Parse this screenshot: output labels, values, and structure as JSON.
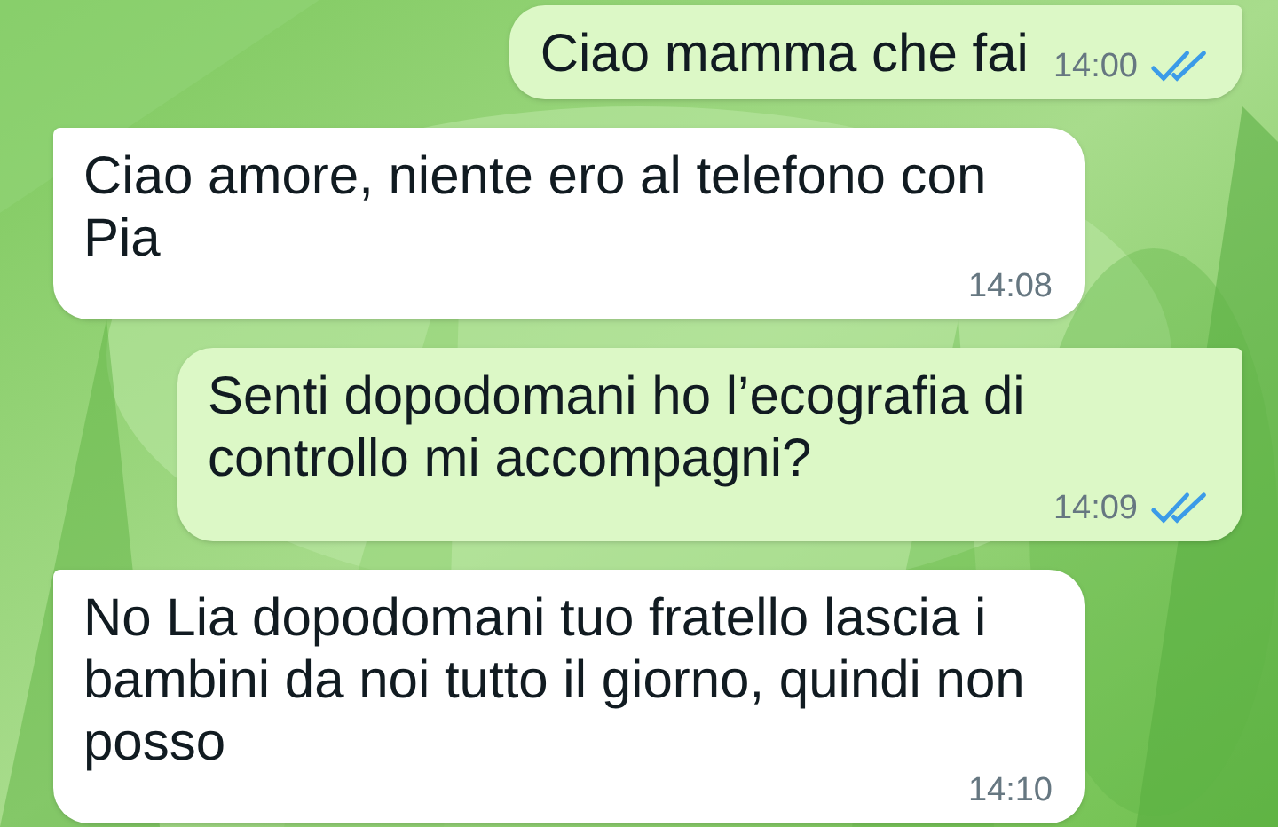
{
  "messages": [
    {
      "kind": "outgoing",
      "text": "Ciao mamma che fai",
      "time": "14:00",
      "read": true
    },
    {
      "kind": "incoming",
      "text": "Ciao amore, niente ero al telefono con Pia",
      "time": "14:08"
    },
    {
      "kind": "outgoing",
      "text": "Senti dopodomani ho l’ecografia di controllo mi accompagni?",
      "time": "14:09",
      "read": true
    },
    {
      "kind": "incoming",
      "text": "No Lia dopodomani tuo fratello lascia i bambini da noi tutto il giorno, quindi non posso",
      "time": "14:10"
    }
  ]
}
